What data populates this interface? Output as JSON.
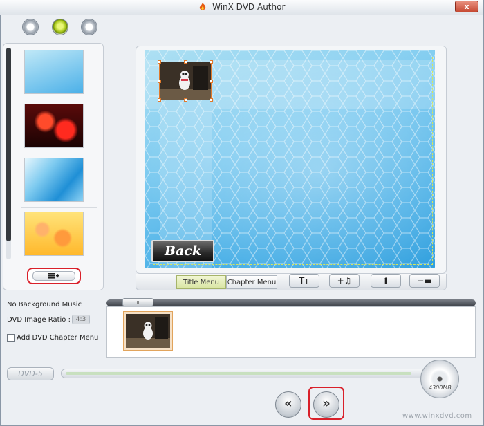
{
  "window": {
    "title": "WinX DVD Author",
    "close_label": "x"
  },
  "templates": {
    "add_icon": "list-add-icon"
  },
  "preview": {
    "back_label": "Back"
  },
  "tabs": [
    {
      "label": "Title Menu",
      "active": true
    },
    {
      "label": "Chapter Menu",
      "active": false
    }
  ],
  "tools": {
    "text_label": "Tт",
    "music_label": "+♫",
    "up_label": "⬆",
    "remove_label": "−▬"
  },
  "settings": {
    "background_music": "No Background Music",
    "image_ratio_label": "DVD Image Ratio :",
    "image_ratio_value": "4:3",
    "chapter_menu_label": "Add DVD Chapter Menu",
    "chapter_menu_checked": false
  },
  "timeline": {
    "grip_label": "ıı"
  },
  "capacity": {
    "disc_type": "DVD-5",
    "disc_size": "4300MB",
    "used_fraction": 0.95
  },
  "navigation": {
    "prev_label": "«",
    "next_label": "»"
  },
  "watermark": "www.winxdvd.com",
  "colors": {
    "highlight": "#d9202a",
    "accent_green": "#a8c71a"
  }
}
